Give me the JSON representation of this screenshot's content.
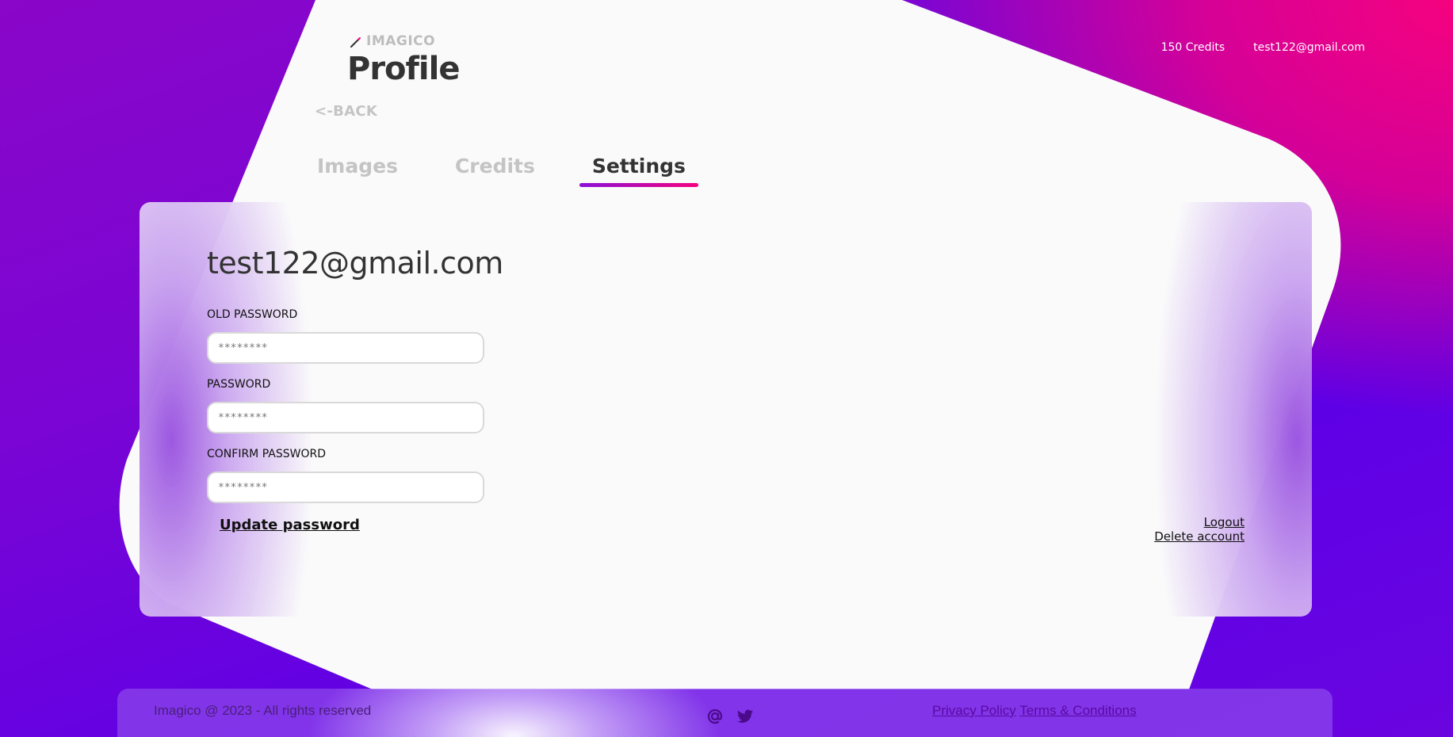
{
  "brand": {
    "name": "IMAGICO",
    "icon": "magic-wand-icon"
  },
  "page": {
    "title": "Profile",
    "back_label": "<-BACK"
  },
  "header": {
    "credits": "150 Credits",
    "user_email": "test122@gmail.com"
  },
  "tabs": [
    {
      "label": "Images",
      "active": false
    },
    {
      "label": "Credits",
      "active": false
    },
    {
      "label": "Settings",
      "active": true
    }
  ],
  "settings": {
    "email_heading": "test122@gmail.com",
    "old_password": {
      "label": "OLD PASSWORD",
      "placeholder": "********",
      "value": ""
    },
    "password": {
      "label": "PASSWORD",
      "placeholder": "********",
      "value": ""
    },
    "confirm_password": {
      "label": "CONFIRM PASSWORD",
      "placeholder": "********",
      "value": ""
    },
    "update_label": "Update password",
    "logout_label": "Logout",
    "delete_label": "Delete account"
  },
  "footer": {
    "copyright": "Imagico @ 2023 - All rights reserved",
    "icons": [
      "email-at-icon",
      "twitter-icon"
    ],
    "privacy_label": "Privacy Policy",
    "terms_label": "Terms & Conditions"
  },
  "colors": {
    "accent_pink": "#f5027f",
    "accent_purple": "#8b10d8",
    "background_violet": "#6a05e0",
    "text_dark": "#333333",
    "text_muted": "#c4c4c4"
  }
}
